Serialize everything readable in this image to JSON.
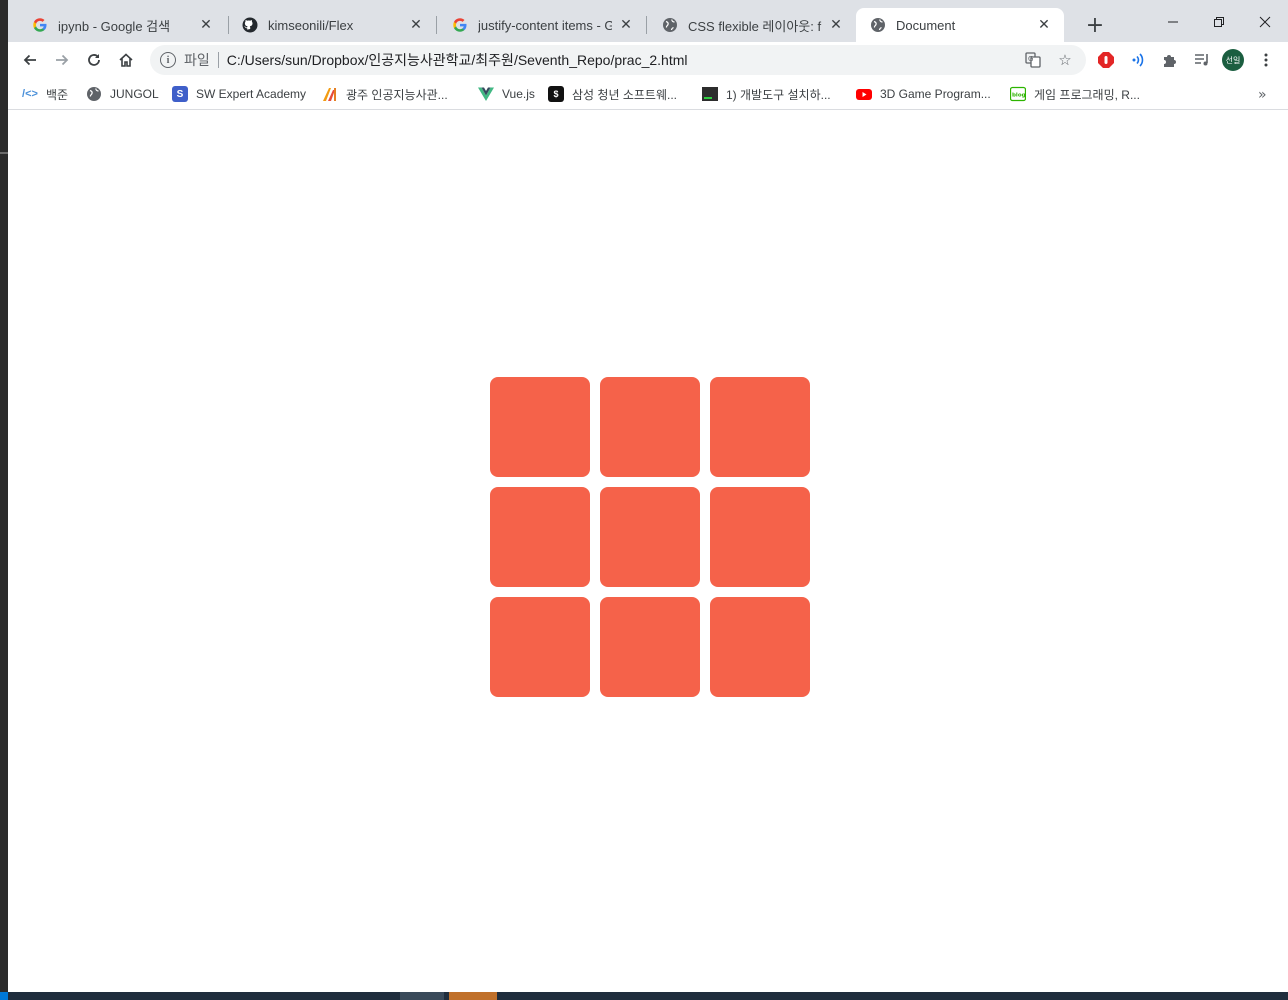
{
  "tabs": [
    {
      "title": "ipynb - Google 검색",
      "icon": "google-icon"
    },
    {
      "title": "kimseonili/Flex",
      "icon": "github-icon"
    },
    {
      "title": "justify-content items - Google",
      "icon": "google-icon"
    },
    {
      "title": "CSS flexible 레이아웃: flex",
      "icon": "globe-icon"
    },
    {
      "title": "Document",
      "icon": "globe-icon",
      "active": true
    }
  ],
  "toolbar": {
    "scheme_label": "파일",
    "url": "C:/Users/sun/Dropbox/인공지능사관학교/최주원/Seventh_Repo/prac_2.html",
    "profile_label": "선일"
  },
  "bookmarks": [
    {
      "label": "백준",
      "icon": "baekjoon-icon"
    },
    {
      "label": "JUNGOL",
      "icon": "globe-icon"
    },
    {
      "label": "SW Expert Academy",
      "icon": "swea-icon"
    },
    {
      "label": "광주 인공지능사관...",
      "icon": "ai-academy-icon"
    },
    {
      "label": "Vue.js",
      "icon": "vue-icon"
    },
    {
      "label": "삼성 청년 소프트웨...",
      "icon": "ssafy-icon"
    },
    {
      "label": "1) 개발도구 설치하...",
      "icon": "terminal-icon"
    },
    {
      "label": "3D Game Program...",
      "icon": "youtube-icon"
    },
    {
      "label": "게임 프로그래밍, R...",
      "icon": "blog-icon"
    }
  ],
  "content": {
    "box_color": "#f5624a",
    "box_count": 9
  }
}
